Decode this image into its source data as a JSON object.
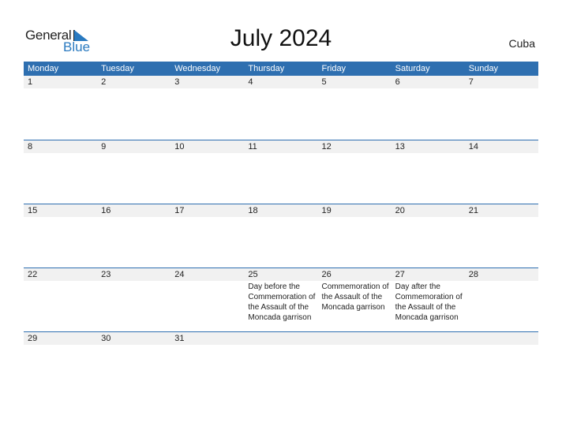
{
  "logo": {
    "general": "General",
    "blue": "Blue"
  },
  "header": {
    "title": "July 2024",
    "country": "Cuba"
  },
  "colors": {
    "accent": "#2e6fb0",
    "band": "#f1f1f1"
  },
  "weekdays": [
    "Monday",
    "Tuesday",
    "Wednesday",
    "Thursday",
    "Friday",
    "Saturday",
    "Sunday"
  ],
  "weeks": [
    [
      {
        "day": "1"
      },
      {
        "day": "2"
      },
      {
        "day": "3"
      },
      {
        "day": "4"
      },
      {
        "day": "5"
      },
      {
        "day": "6"
      },
      {
        "day": "7"
      }
    ],
    [
      {
        "day": "8"
      },
      {
        "day": "9"
      },
      {
        "day": "10"
      },
      {
        "day": "11"
      },
      {
        "day": "12"
      },
      {
        "day": "13"
      },
      {
        "day": "14"
      }
    ],
    [
      {
        "day": "15"
      },
      {
        "day": "16"
      },
      {
        "day": "17"
      },
      {
        "day": "18"
      },
      {
        "day": "19"
      },
      {
        "day": "20"
      },
      {
        "day": "21"
      }
    ],
    [
      {
        "day": "22"
      },
      {
        "day": "23"
      },
      {
        "day": "24"
      },
      {
        "day": "25",
        "event": "Day before the Commemoration of the Assault of the Moncada garrison"
      },
      {
        "day": "26",
        "event": "Commemoration of the Assault of the Moncada garrison"
      },
      {
        "day": "27",
        "event": "Day after the Commemoration of the Assault of the Moncada garrison"
      },
      {
        "day": "28"
      }
    ],
    [
      {
        "day": "29"
      },
      {
        "day": "30"
      },
      {
        "day": "31"
      },
      {
        "day": ""
      },
      {
        "day": ""
      },
      {
        "day": ""
      },
      {
        "day": ""
      }
    ]
  ]
}
